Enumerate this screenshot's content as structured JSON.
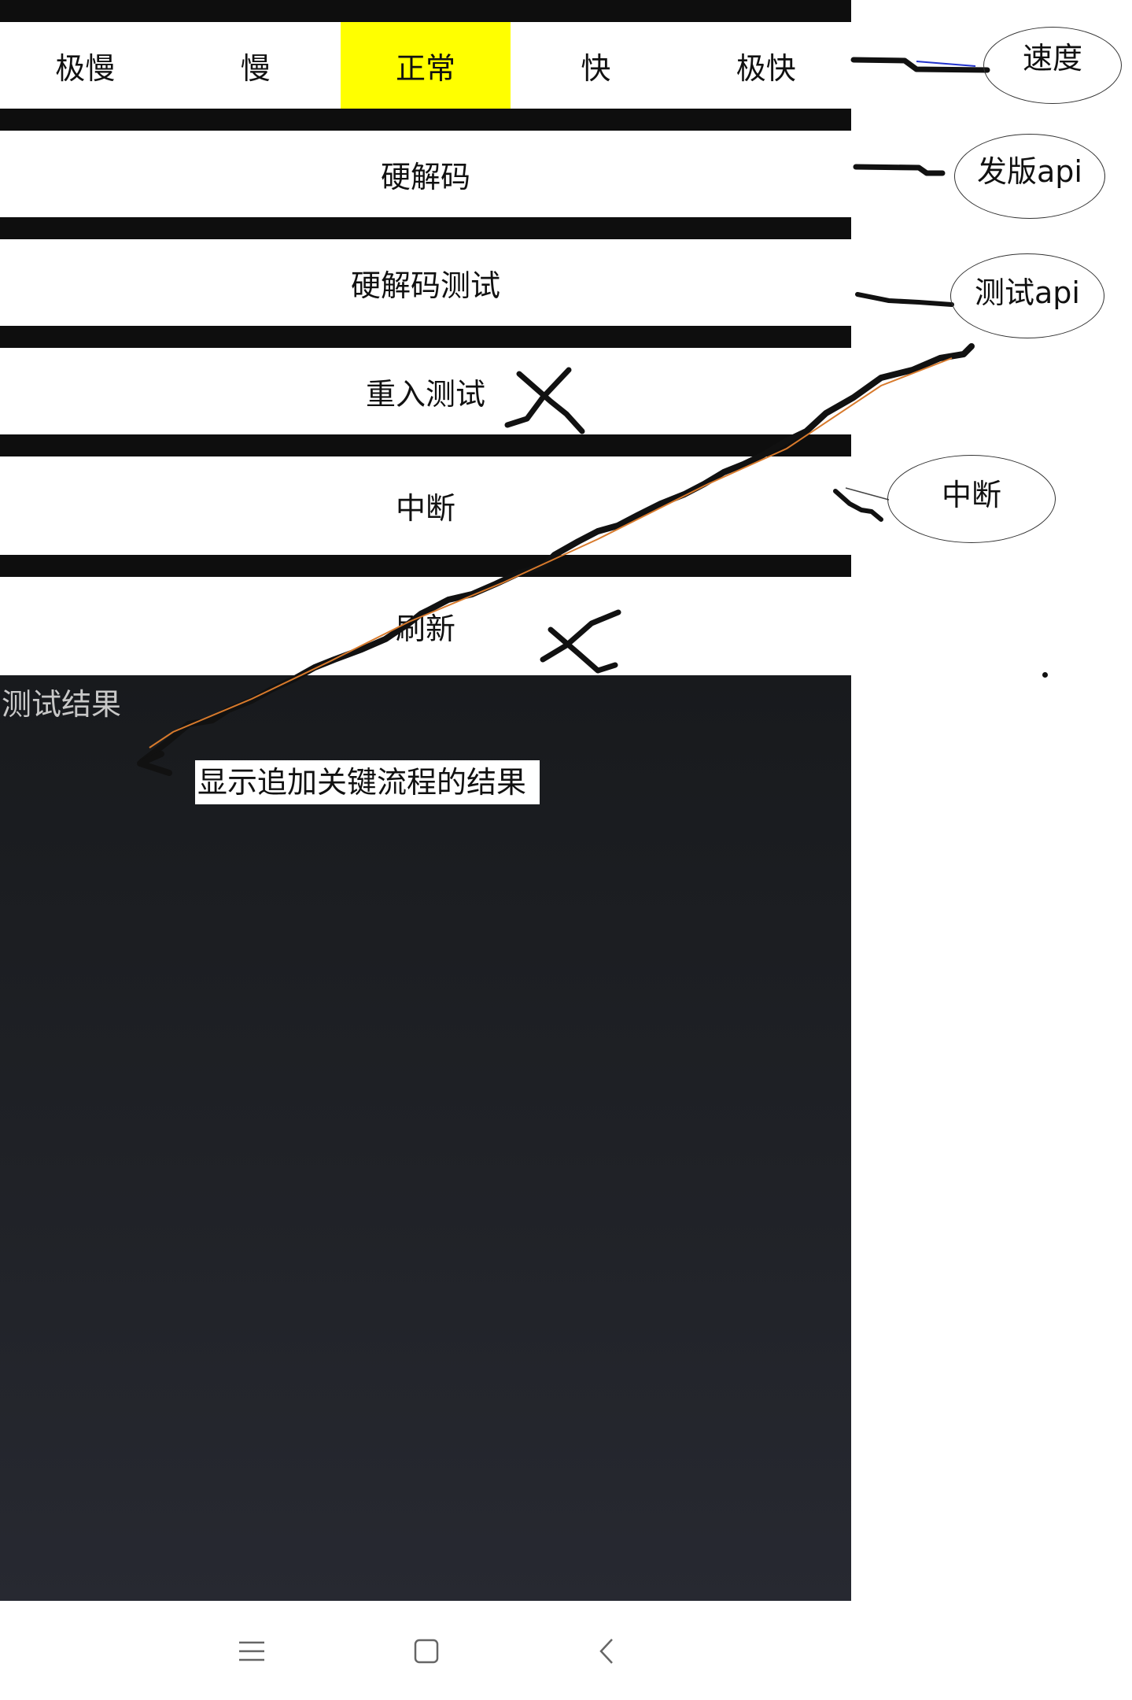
{
  "speed": {
    "options": [
      "极慢",
      "慢",
      "正常",
      "快",
      "极快"
    ],
    "selected": "正常"
  },
  "buttons": {
    "hard_decode": "硬解码",
    "hard_decode_test": "硬解码测试",
    "reentry_test": "重入测试",
    "interrupt": "中断",
    "refresh": "刷新"
  },
  "results": {
    "title": "测试结果",
    "note": "显示追加关键流程的结果"
  },
  "annotations": {
    "speed": "速度",
    "release_api": "发版api",
    "test_api": "测试api",
    "interrupt": "中断"
  },
  "nav": {
    "menu_icon": "menu-icon",
    "home_icon": "home-icon",
    "back_icon": "back-icon"
  },
  "colors": {
    "selected": "#ffff00",
    "background": "#0e0e0e",
    "row": "#ffffff"
  }
}
